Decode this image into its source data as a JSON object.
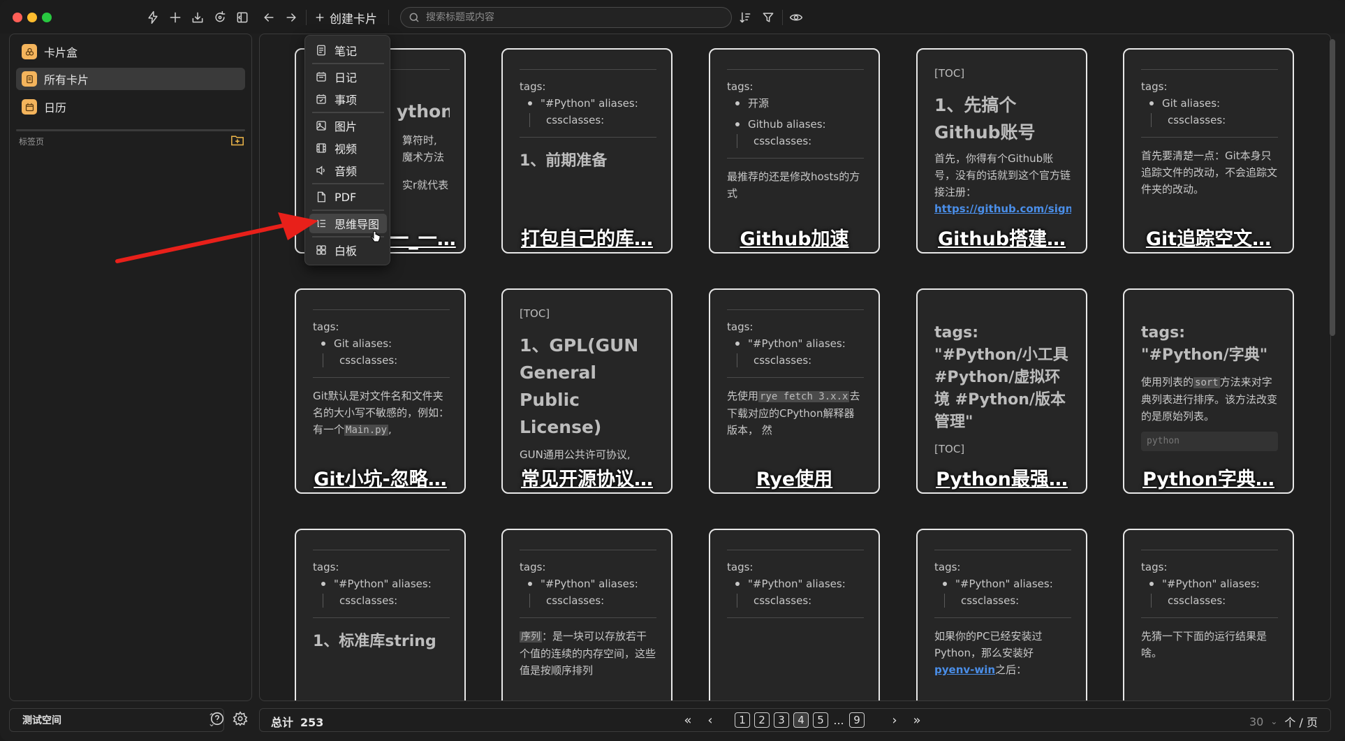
{
  "toolbar": {
    "create_card_label": "创建卡片",
    "search_placeholder": "搜索标题或内容"
  },
  "sidebar": {
    "items": [
      {
        "label": "卡片盒",
        "icon": "cardbox-icon"
      },
      {
        "label": "所有卡片",
        "icon": "cards-icon"
      },
      {
        "label": "日历",
        "icon": "calendar-icon"
      }
    ],
    "section_label": "标签页"
  },
  "dropdown": {
    "items": [
      {
        "label": "笔记",
        "icon": "note-icon"
      },
      {
        "label": "日记",
        "icon": "diary-icon"
      },
      {
        "label": "事项",
        "icon": "task-icon"
      },
      {
        "label": "图片",
        "icon": "image-icon"
      },
      {
        "label": "视频",
        "icon": "video-icon"
      },
      {
        "label": "音频",
        "icon": "audio-icon"
      },
      {
        "label": "PDF",
        "icon": "pdf-icon"
      },
      {
        "label": "思维导图",
        "icon": "mindmap-icon"
      },
      {
        "label": "白板",
        "icon": "whiteboard-icon"
      }
    ]
  },
  "cards": [
    {
      "title": "一_一…",
      "lines": [
        "ython/",
        "算符时,",
        "魔术方法",
        "实r就代表"
      ]
    },
    {
      "title": "打包自己的库…",
      "tags_label": "tags:",
      "tag_item": "\"#Python\" aliases:",
      "tag_item2": "cssclasses:",
      "heading": "1、前期准备"
    },
    {
      "title": "Github加速",
      "tags_label": "tags:",
      "tag_item": "开源",
      "tag_item_b": "Github aliases:",
      "tag_item2": "cssclasses:",
      "body": "最推荐的还是修改hosts的方式"
    },
    {
      "title": "Github搭建…",
      "toc": "[TOC]",
      "heading": "1、先搞个Github账号",
      "body": "首先，你得有个Github账号，没有的话就到这个官方链接注册：",
      "link": "https://github.com/sign"
    },
    {
      "title": "Git追踪空文…",
      "tags_label": "tags:",
      "tag_item": "Git aliases:",
      "tag_item2": "cssclasses:",
      "body": "首先要清楚一点：Git本身只追踪文件的改动，不会追踪文件夹的改动。"
    },
    {
      "title": "Git小坑-忽略…",
      "tags_label": "tags:",
      "tag_item": "Git aliases:",
      "tag_item2": "cssclasses:",
      "body_a": "Git默认是对文件名和文件夹名的大小写不敏感的，例如：有一个",
      "code": "Main.py",
      "body_b": ","
    },
    {
      "title": "常见开源协议…",
      "toc": "[TOC]",
      "heading": "1、GPL(GUN General Public License)",
      "body": "GUN通用公共许可协议,"
    },
    {
      "title": "Rye使用",
      "tags_label": "tags:",
      "tag_item": "\"#Python\" aliases:",
      "tag_item2": "cssclasses:",
      "body_a": "先使用",
      "code": "rye fetch 3.x.x",
      "body_b": "去下载对应的CPython解释器版本， 然"
    },
    {
      "title": "Python最强…",
      "heading": "tags: \"#Python/小工具 #Python/虚拟环境 #Python/版本管理\"",
      "toc": "[TOC]"
    },
    {
      "title": "Python字典…",
      "heading": "tags: \"#Python/字典\"",
      "body_a": "使用列表的",
      "code": "sort",
      "body_b": "方法来对字典列表进行排序。该方法改变的是原始列表。",
      "code2": "python"
    },
    {
      "tags_label": "tags:",
      "tag_item": "\"#Python\" aliases:",
      "tag_item2": "cssclasses:",
      "heading": "1、标准库string"
    },
    {
      "tags_label": "tags:",
      "tag_item": "\"#Python\" aliases:",
      "tag_item2": "cssclasses:",
      "code": "序列",
      "body": "：是一块可以存放若干个值的连续的内存空间，这些值是按顺序排列"
    },
    {
      "tags_label": "tags:",
      "tag_item": "\"#Python\" aliases:",
      "tag_item2": "cssclasses:"
    },
    {
      "tags_label": "tags:",
      "tag_item": "\"#Python\" aliases:",
      "tag_item2": "cssclasses:",
      "body": "如果你的PC已经安装过Python，那么安装好",
      "link": "pyenv-win",
      "body_b": "之后："
    },
    {
      "tags_label": "tags:",
      "tag_item": "\"#Python\" aliases:",
      "tag_item2": "cssclasses:",
      "body": "先猜一下下面的运行结果是啥。"
    }
  ],
  "footer": {
    "workspace": "测试空间",
    "total_label": "总计",
    "total_value": "253",
    "pages": [
      "1",
      "2",
      "3",
      "4",
      "5",
      "9"
    ],
    "dots": "...",
    "current_page": "4",
    "per_page_value": "30",
    "per_page_unit": "个 / 页"
  },
  "colors": {
    "accent_orange": "#f4b45c",
    "arrow_red": "#e8201a",
    "link_blue": "#4a8ee8"
  }
}
